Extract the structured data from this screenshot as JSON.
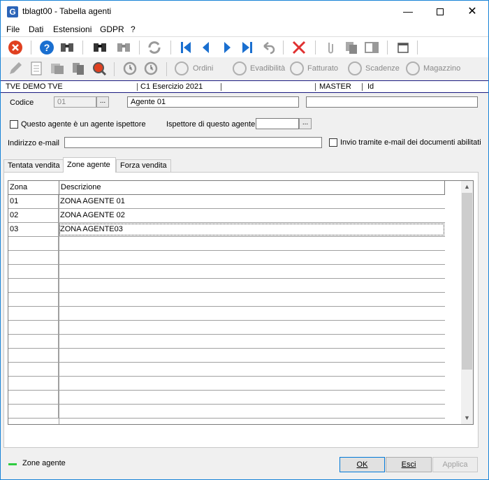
{
  "window": {
    "title": "tblagt00 - Tabella agenti",
    "app_icon_letter": "G"
  },
  "menu": {
    "items": [
      "File",
      "Dati",
      "Estensioni",
      "GDPR",
      "?"
    ]
  },
  "toolbar2": {
    "labels": [
      "Ordini",
      "Evadibilità",
      "Fatturato",
      "Scadenze",
      "Magazzino"
    ]
  },
  "info": {
    "company": "TVE DEMO TVE",
    "exercise": "C1 Esercizio 2021",
    "user": "MASTER",
    "id": "Id"
  },
  "form": {
    "codice_label": "Codice",
    "codice_value": "01",
    "descrizione_value": "Agente  01",
    "extra_value": "",
    "ispettore_check_label": "Questo agente è un agente ispettore",
    "ispettore_label": "Ispettore di questo agente",
    "ispettore_value": "",
    "email_label": "Indirizzo e-mail",
    "email_value": "",
    "invio_label": "Invio tramite e-mail dei documenti abilitati",
    "dots": "..."
  },
  "tabs": [
    "Tentata vendita",
    "Zone agente",
    "Forza vendita"
  ],
  "grid": {
    "columns": [
      "Zona",
      "Descrizione"
    ],
    "rows": [
      {
        "zona": "01",
        "descrizione": "ZONA AGENTE 01"
      },
      {
        "zona": "02",
        "descrizione": "ZONA AGENTE 02"
      },
      {
        "zona": "03",
        "descrizione": "ZONA AGENTE03"
      }
    ]
  },
  "status": {
    "text": "Zone agente",
    "color": "#2ecc40"
  },
  "buttons": {
    "ok": "OK",
    "esci": "Esci",
    "applica": "Applica"
  },
  "colors": {
    "accent": "#0078d7",
    "close_red": "#e04020",
    "help_blue": "#1a6fd0"
  }
}
